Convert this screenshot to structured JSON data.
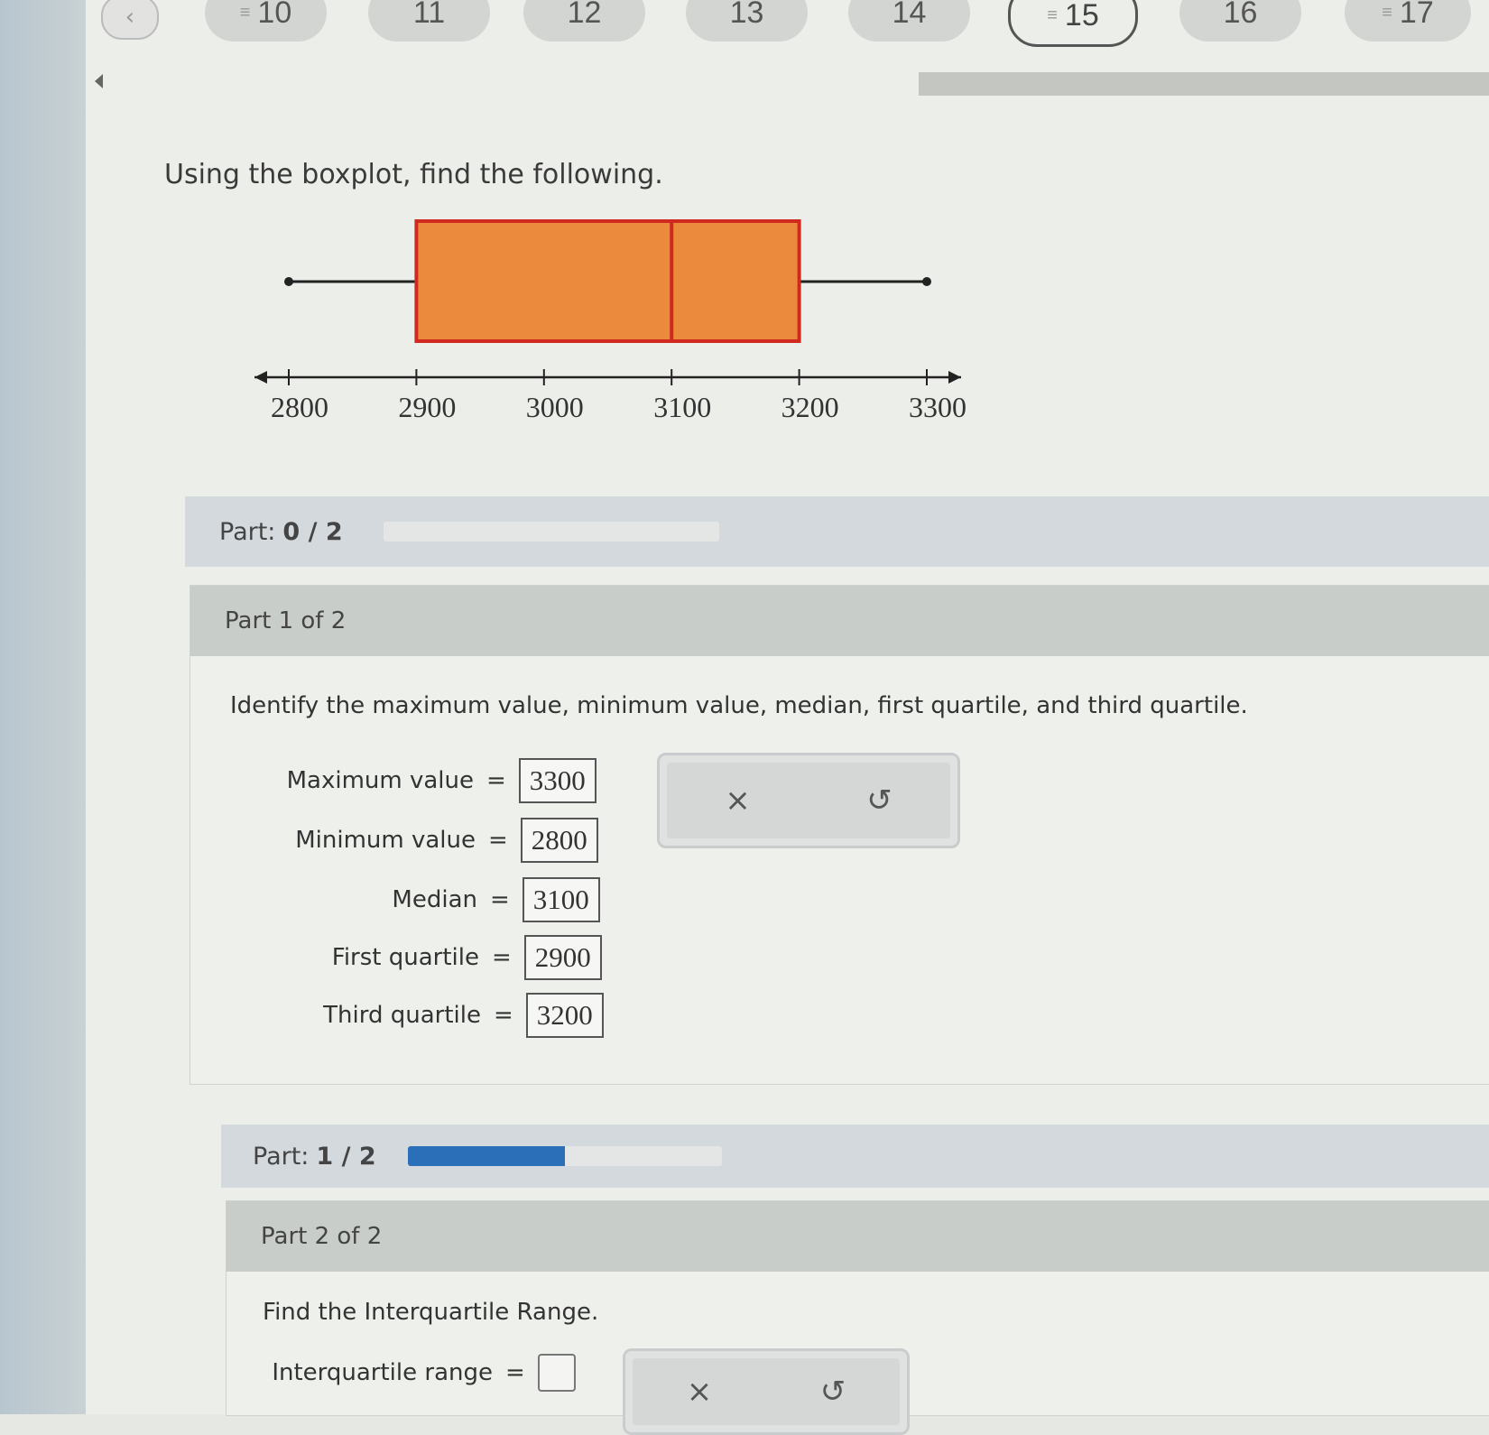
{
  "nav": {
    "questions": [
      {
        "label": "10",
        "flag": true
      },
      {
        "label": "11",
        "flag": false
      },
      {
        "label": "12",
        "flag": false
      },
      {
        "label": "13",
        "flag": false
      },
      {
        "label": "14",
        "flag": false
      },
      {
        "label": "15",
        "flag": true,
        "active": true
      },
      {
        "label": "16",
        "flag": false
      },
      {
        "label": "17",
        "flag": true
      }
    ]
  },
  "prompt": "Using the boxplot, find the following.",
  "chart_data": {
    "type": "boxplot",
    "min": 2800,
    "q1": 2900,
    "median": 3100,
    "q3": 3200,
    "max": 3300,
    "ticks": [
      "2800",
      "2900",
      "3000",
      "3100",
      "3200",
      "3300"
    ],
    "xlim": [
      2800,
      3300
    ],
    "box_color": "#eb8a3c",
    "box_border": "#d02a20"
  },
  "part_status_1": {
    "label": "Part:",
    "value": "0 / 2",
    "progress": 0
  },
  "part1": {
    "header": "Part 1 of 2",
    "instruction": "Identify the maximum value, minimum value, median, first quartile, and third quartile.",
    "rows": [
      {
        "label": "Maximum value",
        "eq": "=",
        "value": "3300"
      },
      {
        "label": "Minimum value",
        "eq": "=",
        "value": "2800"
      },
      {
        "label": "Median",
        "eq": "=",
        "value": "3100"
      },
      {
        "label": "First quartile",
        "eq": "=",
        "value": "2900"
      },
      {
        "label": "Third quartile",
        "eq": "=",
        "value": "3200"
      }
    ],
    "tools": {
      "clear": "×",
      "undo": "↺"
    }
  },
  "part_status_2": {
    "label": "Part:",
    "value": "1 / 2",
    "progress": 0.5
  },
  "part2": {
    "header": "Part 2 of 2",
    "instruction": "Find the Interquartile Range.",
    "row": {
      "label": "Interquartile range",
      "eq": "=",
      "value": ""
    },
    "tools": {
      "clear": "×",
      "undo": "↺"
    }
  },
  "icons": {
    "back": "chevron-left-icon",
    "flag": "flag-icon",
    "clear": "close-icon",
    "undo": "undo-icon"
  }
}
